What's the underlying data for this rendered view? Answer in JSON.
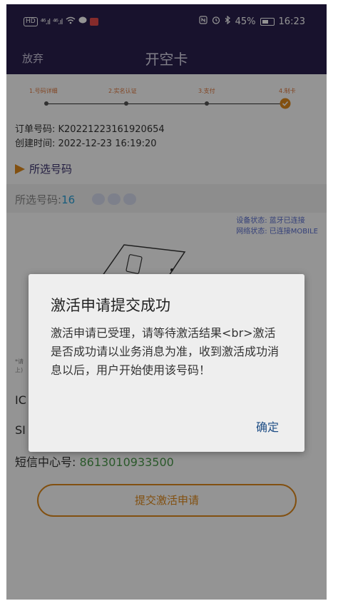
{
  "status_bar": {
    "left_icons": [
      "hd-icon",
      "signal-icon",
      "signal-icon",
      "wifi-icon",
      "chat-icon",
      "message-icon"
    ],
    "signal1": "⁴⁶.ıl",
    "signal2": "⁴⁶.ıl",
    "battery_percent": "45%",
    "time": "16:23"
  },
  "header": {
    "back_label": "放弃",
    "title": "开空卡"
  },
  "stepper": {
    "steps": [
      {
        "label": "1.号码详细"
      },
      {
        "label": "2.实名认证"
      },
      {
        "label": "3.支付"
      },
      {
        "label": "4.制卡"
      }
    ]
  },
  "order": {
    "number_label": "订单号码: K20221223161920654",
    "created_label": "创建时间: 2022-12-23 16:19:20"
  },
  "selected_section": {
    "title": "所选号码",
    "label": "所选号码:",
    "number_visible": "16"
  },
  "device": {
    "device_status": "设备状态: 蓝牙已连接",
    "network_status": "网络状态: 已连接MOBILE"
  },
  "info": {
    "note": "*请\n上)",
    "iccid_label": "IC",
    "imsi_label": "SI",
    "sms_center_label": "短信中心号:",
    "sms_center_value": "8613010933500"
  },
  "submit_button": "提交激活申请",
  "dialog": {
    "title": "激活申请提交成功",
    "message": "激活申请已受理，请等待激活结果<br>激活是否成功请以业务消息为准，收到激活成功消息以后，用户开始使用该号码！",
    "ok_label": "确定"
  },
  "colors": {
    "header_bg": "#2a1f4f",
    "accent_orange": "#e08a1c",
    "dialog_ok": "#1f4e86"
  }
}
